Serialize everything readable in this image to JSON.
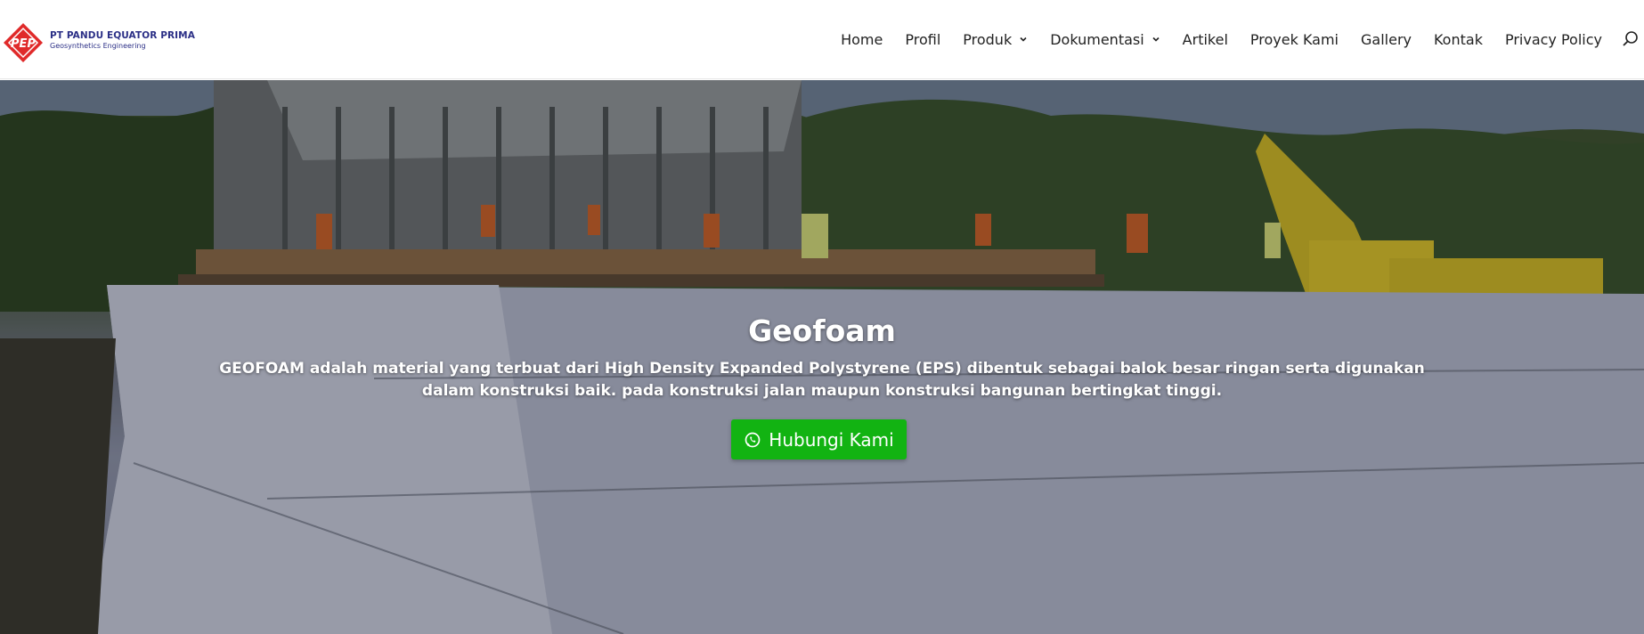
{
  "brand": {
    "name": "PT PANDU EQUATOR PRIMA",
    "tagline": "Geosynthetics Engineering",
    "logo_text": "PEP",
    "colors": {
      "primary": "#e02a2a",
      "secondary": "#2b2f86"
    }
  },
  "nav": {
    "items": [
      {
        "label": "Home",
        "dropdown": false
      },
      {
        "label": "Profil",
        "dropdown": false
      },
      {
        "label": "Produk",
        "dropdown": true
      },
      {
        "label": "Dokumentasi",
        "dropdown": true
      },
      {
        "label": "Artikel",
        "dropdown": false
      },
      {
        "label": "Proyek Kami",
        "dropdown": false
      },
      {
        "label": "Gallery",
        "dropdown": false
      },
      {
        "label": "Kontak",
        "dropdown": false
      },
      {
        "label": "Privacy Policy",
        "dropdown": false
      }
    ],
    "search_icon": "search-icon"
  },
  "hero": {
    "title": "Geofoam",
    "description": "GEOFOAM adalah material yang terbuat dari High Density Expanded Polystyrene (EPS) dibentuk sebagai balok besar ringan serta digunakan dalam konstruksi baik. pada konstruksi jalan maupun konstruksi bangunan bertingkat tinggi.",
    "cta": {
      "label": "Hubungi Kami",
      "icon": "whatsapp-icon",
      "color": "#12b312"
    }
  }
}
